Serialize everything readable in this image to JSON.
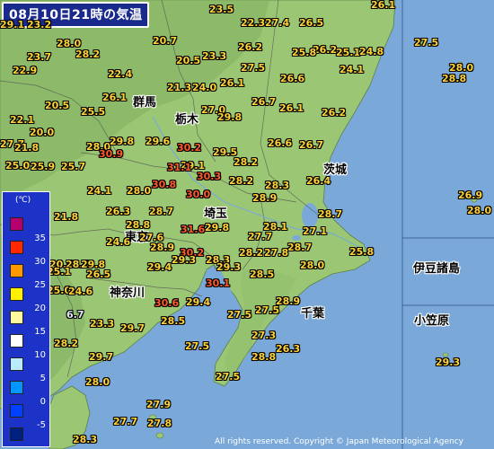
{
  "title": "08月10日21時の気温",
  "copyright": "All rights reserved. Copyright © Japan Meteorological Agency",
  "legend": {
    "unit": "(℃)",
    "items": [
      {
        "label": "35",
        "color": "#b4006e"
      },
      {
        "label": "30",
        "color": "#ff2800"
      },
      {
        "label": "25",
        "color": "#ff9900"
      },
      {
        "label": "20",
        "color": "#fff000"
      },
      {
        "label": "15",
        "color": "#fffaa0"
      },
      {
        "label": "10",
        "color": "#ffffff"
      },
      {
        "label": "5",
        "color": "#b9ebff"
      },
      {
        "label": "0",
        "color": "#0096ff"
      },
      {
        "label": "-5",
        "color": "#0041ff"
      },
      {
        "label": "",
        "color": "#002080"
      }
    ]
  },
  "prefectures": [
    {
      "name": "群馬"
    },
    {
      "name": "栃木"
    },
    {
      "name": "茨城"
    },
    {
      "name": "埼玉"
    },
    {
      "name": "東京"
    },
    {
      "name": "神奈川"
    },
    {
      "name": "千葉"
    },
    {
      "name": "伊豆諸島"
    },
    {
      "name": "小笠原"
    }
  ],
  "readings": [
    {
      "value": "29.1"
    },
    {
      "value": "23.2"
    },
    {
      "value": "23.5"
    },
    {
      "value": "22.3"
    },
    {
      "value": "27.4"
    },
    {
      "value": "26.5"
    },
    {
      "value": "26.1"
    },
    {
      "value": "28.0"
    },
    {
      "value": "20.7"
    },
    {
      "value": "26.2"
    },
    {
      "value": "26.2"
    },
    {
      "value": "23.7"
    },
    {
      "value": "28.2"
    },
    {
      "value": "20.5"
    },
    {
      "value": "23.3"
    },
    {
      "value": "27.5"
    },
    {
      "value": "25.8"
    },
    {
      "value": "25.1"
    },
    {
      "value": "24.8"
    },
    {
      "value": "22.9"
    },
    {
      "value": "22.4"
    },
    {
      "value": "24.1"
    },
    {
      "value": "21.3"
    },
    {
      "value": "24.0"
    },
    {
      "value": "26.1"
    },
    {
      "value": "26.6"
    },
    {
      "value": "26.1"
    },
    {
      "value": "26.7"
    },
    {
      "value": "20.5"
    },
    {
      "value": "25.5"
    },
    {
      "value": "27.0"
    },
    {
      "value": "26.1"
    },
    {
      "value": "26.2"
    },
    {
      "value": "22.1"
    },
    {
      "value": "29.8"
    },
    {
      "value": "20.0"
    },
    {
      "value": "29.6"
    },
    {
      "value": "27.7"
    },
    {
      "value": "28.0"
    },
    {
      "value": "29.8"
    },
    {
      "value": "30.2"
    },
    {
      "value": "29.5"
    },
    {
      "value": "26.6"
    },
    {
      "value": "26.7"
    },
    {
      "value": "21.8"
    },
    {
      "value": "30.9"
    },
    {
      "value": "29.1"
    },
    {
      "value": "25.0"
    },
    {
      "value": "25.9"
    },
    {
      "value": "25.7"
    },
    {
      "value": "31.1"
    },
    {
      "value": "28.2"
    },
    {
      "value": "30.3"
    },
    {
      "value": "30.8"
    },
    {
      "value": "28.2"
    },
    {
      "value": "26.4"
    },
    {
      "value": "24.1"
    },
    {
      "value": "28.0"
    },
    {
      "value": "30.0"
    },
    {
      "value": "28.3"
    },
    {
      "value": "28.9"
    },
    {
      "value": "26.3"
    },
    {
      "value": "28.7"
    },
    {
      "value": "28.7"
    },
    {
      "value": "21.8"
    },
    {
      "value": "31.6"
    },
    {
      "value": "29.8"
    },
    {
      "value": "28.1"
    },
    {
      "value": "27.1"
    },
    {
      "value": "28.8"
    },
    {
      "value": "27.6"
    },
    {
      "value": "27.7"
    },
    {
      "value": "28.7"
    },
    {
      "value": "24.6"
    },
    {
      "value": "28.9"
    },
    {
      "value": "27.8"
    },
    {
      "value": "25.8"
    },
    {
      "value": "30.2"
    },
    {
      "value": "28.2"
    },
    {
      "value": "20.0"
    },
    {
      "value": "28.3"
    },
    {
      "value": "29.3"
    },
    {
      "value": "28.3"
    },
    {
      "value": "28.0"
    },
    {
      "value": "29.8"
    },
    {
      "value": "25.1"
    },
    {
      "value": "29.4"
    },
    {
      "value": "28.5"
    },
    {
      "value": "26.5"
    },
    {
      "value": "29.3"
    },
    {
      "value": "25.0"
    },
    {
      "value": "24.6"
    },
    {
      "value": "30.1"
    },
    {
      "value": "30.6"
    },
    {
      "value": "29.4"
    },
    {
      "value": "28.9"
    },
    {
      "value": "6.7"
    },
    {
      "value": "27.5"
    },
    {
      "value": "27.5"
    },
    {
      "value": "23.3"
    },
    {
      "value": "28.5"
    },
    {
      "value": "29.7"
    },
    {
      "value": "28.2"
    },
    {
      "value": "27.3"
    },
    {
      "value": "27.5"
    },
    {
      "value": "26.3"
    },
    {
      "value": "29.7"
    },
    {
      "value": "28.8"
    },
    {
      "value": "27.5"
    },
    {
      "value": "30.2"
    },
    {
      "value": "28.0"
    },
    {
      "value": "27.9"
    },
    {
      "value": "27.7"
    },
    {
      "value": "27.8"
    },
    {
      "value": "28.3"
    },
    {
      "value": "27.5"
    },
    {
      "value": "28.0"
    },
    {
      "value": "28.8"
    },
    {
      "value": "26.9"
    },
    {
      "value": "28.0"
    },
    {
      "value": "29.3"
    }
  ]
}
